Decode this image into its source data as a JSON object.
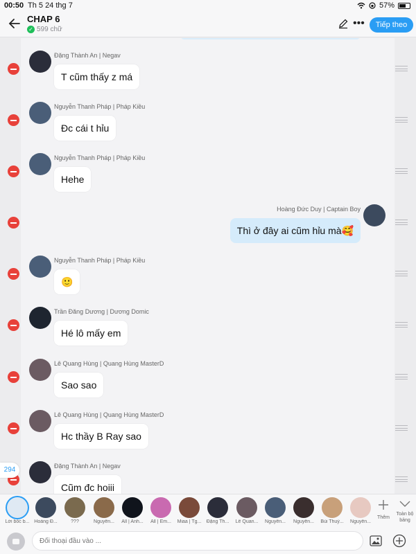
{
  "status_bar": {
    "time": "00:50",
    "date": "Th 5 24 thg 7",
    "battery": "57%",
    "battery_level": 0.57
  },
  "header": {
    "title": "CHAP 6",
    "word_count": "599 chữ",
    "next_label": "Tiếp theo"
  },
  "messages": [
    {
      "name": "Đặng Thành An | Negav",
      "text": "T cũm thấy z má",
      "side": "in",
      "avatar_color": "#2b2d3a"
    },
    {
      "name": "Nguyễn Thanh Pháp | Pháp Kiều",
      "text": "Đc cái t hỉu",
      "side": "in",
      "avatar_color": "#4a5e78"
    },
    {
      "name": "Nguyễn Thanh Pháp | Pháp Kiều",
      "text": "Hehe",
      "side": "in",
      "avatar_color": "#4a5e78"
    },
    {
      "name": "Hoàng Đức Duy | Captain Boy",
      "text": "Thì ở đây ai cũm hỉu mà🥰",
      "side": "out",
      "avatar_color": "#3c4a5e"
    },
    {
      "name": "Nguyễn Thanh Pháp | Pháp Kiều",
      "text": "🙂",
      "side": "in",
      "avatar_color": "#4a5e78"
    },
    {
      "name": "Trần Đăng Dương | Dương Domic",
      "text": "Hé lô mấy em",
      "side": "in",
      "avatar_color": "#1e2530"
    },
    {
      "name": "Lê Quang Hùng | Quang Hùng MasterD",
      "text": "Sao sao",
      "side": "in",
      "avatar_color": "#6b5b62"
    },
    {
      "name": "Lê Quang Hùng | Quang Hùng MasterD",
      "text": "Hc thầy B Ray sao",
      "side": "in",
      "avatar_color": "#6b5b62"
    },
    {
      "name": "Đặng Thành An | Negav",
      "text": "Cũm đc hoiii",
      "side": "in",
      "avatar_color": "#2b2d3a"
    }
  ],
  "message_count": "294",
  "characters": [
    {
      "name": "Lời bóc b...",
      "color": "#dfe9f3",
      "selected": true
    },
    {
      "name": "Hoàng Đ...",
      "color": "#3c4a5e"
    },
    {
      "name": "???",
      "color": "#7a6a4e"
    },
    {
      "name": "Nguyễn...",
      "color": "#8a6a4a"
    },
    {
      "name": "All | Anh...",
      "color": "#10141c"
    },
    {
      "name": "All | Em...",
      "color": "#c96ab0"
    },
    {
      "name": "Miaa | Tg...",
      "color": "#7a4a3a"
    },
    {
      "name": "Đặng Th...",
      "color": "#2b2d3a"
    },
    {
      "name": "Lê Quan...",
      "color": "#6b5b62"
    },
    {
      "name": "Nguyễn...",
      "color": "#4a5e78"
    },
    {
      "name": "Nguyễn...",
      "color": "#3a2e2e"
    },
    {
      "name": "Bùi Thuỳ...",
      "color": "#c8a07a"
    },
    {
      "name": "Nguyễn...",
      "color": "#e7c9c1"
    }
  ],
  "add_label": "Thêm",
  "collapse_label": "Toàn bộ bảng",
  "input": {
    "placeholder": "Đối thoại đầu vào ..."
  },
  "colors": {
    "accent": "#2a9df4",
    "delete": "#e8413a",
    "outgoing_bubble": "#d5ebfb"
  }
}
